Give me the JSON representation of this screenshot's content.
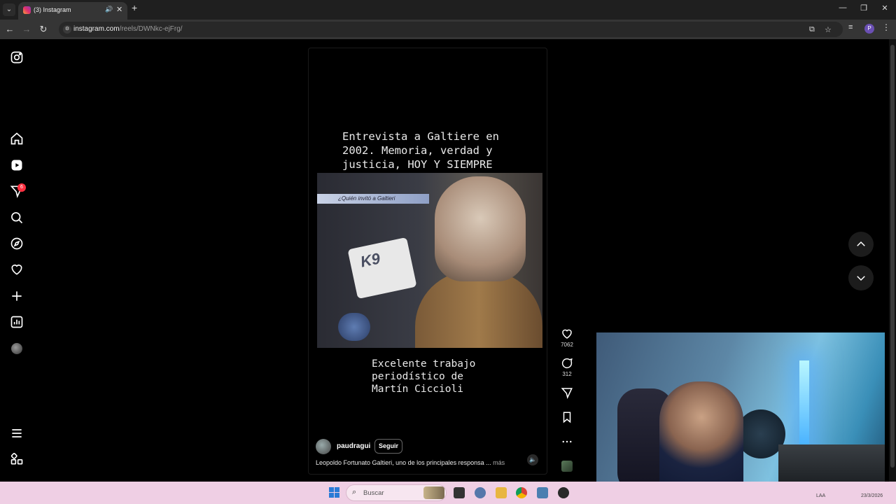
{
  "browser": {
    "tab_title": "(3) Instagram",
    "url_domain": "instagram.com",
    "url_path": "/reels/DWNkc-ejFrg/"
  },
  "sidebar": {
    "notification_count": "6",
    "items": [
      "instagram-logo-icon",
      "home-icon",
      "reels-icon",
      "messages-icon",
      "search-icon",
      "explore-icon",
      "notifications-icon",
      "create-icon",
      "dashboard-icon",
      "profile-avatar",
      "more-menu-icon",
      "also-from-meta-icon"
    ]
  },
  "reel": {
    "overlay_title": "Entrevista a Galtiere en\n2002. Memoria, verdad y\njusticia, HOY Y SIEMPRE",
    "video_banner": "¿Quién invitó a Galtieri",
    "video_mic_logo": "K9",
    "overlay_caption": "Excelente trabajo\nperiodístico de\nMartín Ciccioli",
    "username": "paudragui",
    "follow_label": "Seguir",
    "description": "Leopoldo Fortunato Galtieri, uno de los principales responsa ...",
    "more_label": "más"
  },
  "actions": {
    "likes": "7062",
    "comments": "312"
  },
  "taskbar": {
    "search_placeholder": "Buscar",
    "language": "LAA",
    "date": "23/3/2026"
  },
  "colors": {
    "notification_badge": "#ff3040",
    "taskbar": "#efcfe4",
    "page_background": "#000000"
  }
}
